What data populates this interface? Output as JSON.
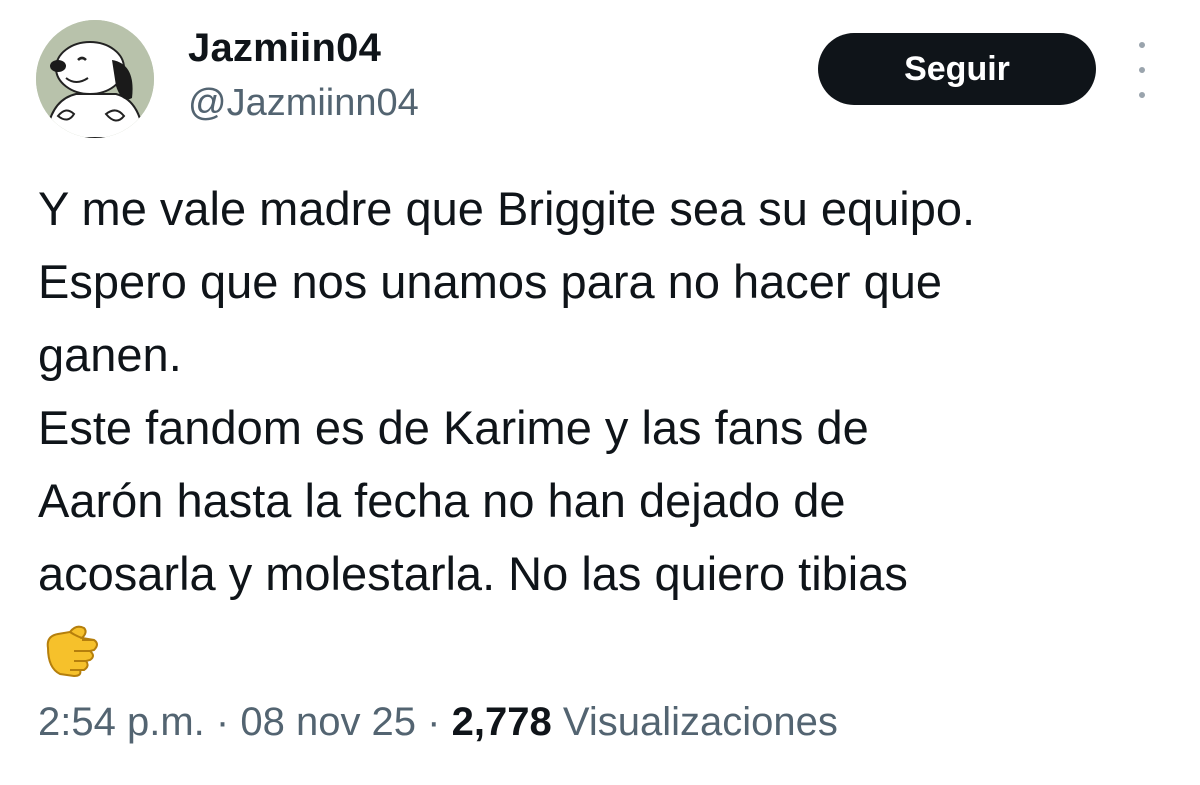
{
  "user": {
    "display_name": "Jazmiin04",
    "handle": "@Jazmiinn04",
    "avatar_icon": "snoopy-avatar"
  },
  "actions": {
    "follow_label": "Seguir",
    "more_icon": "more-options-icon"
  },
  "tweet": {
    "lines": [
      "Y me vale madre que Briggite sea su equipo.",
      "Espero que nos unamos para no hacer que",
      "ganen.",
      "Este fandom es de Karime y las fans de",
      "Aarón hasta la fecha no han dejado de",
      "acosarla y molestarla. No las quiero tibias"
    ],
    "emoji_icon": "pointing-hand-emoji"
  },
  "meta": {
    "time": "2:54 p.m.",
    "separator": "·",
    "date": "08 nov 25",
    "views_count": "2,778",
    "views_label": "Visualizaciones"
  },
  "colors": {
    "text_primary": "#0f1419",
    "text_secondary": "#536471",
    "button_bg": "#0f1419",
    "button_text": "#ffffff"
  }
}
